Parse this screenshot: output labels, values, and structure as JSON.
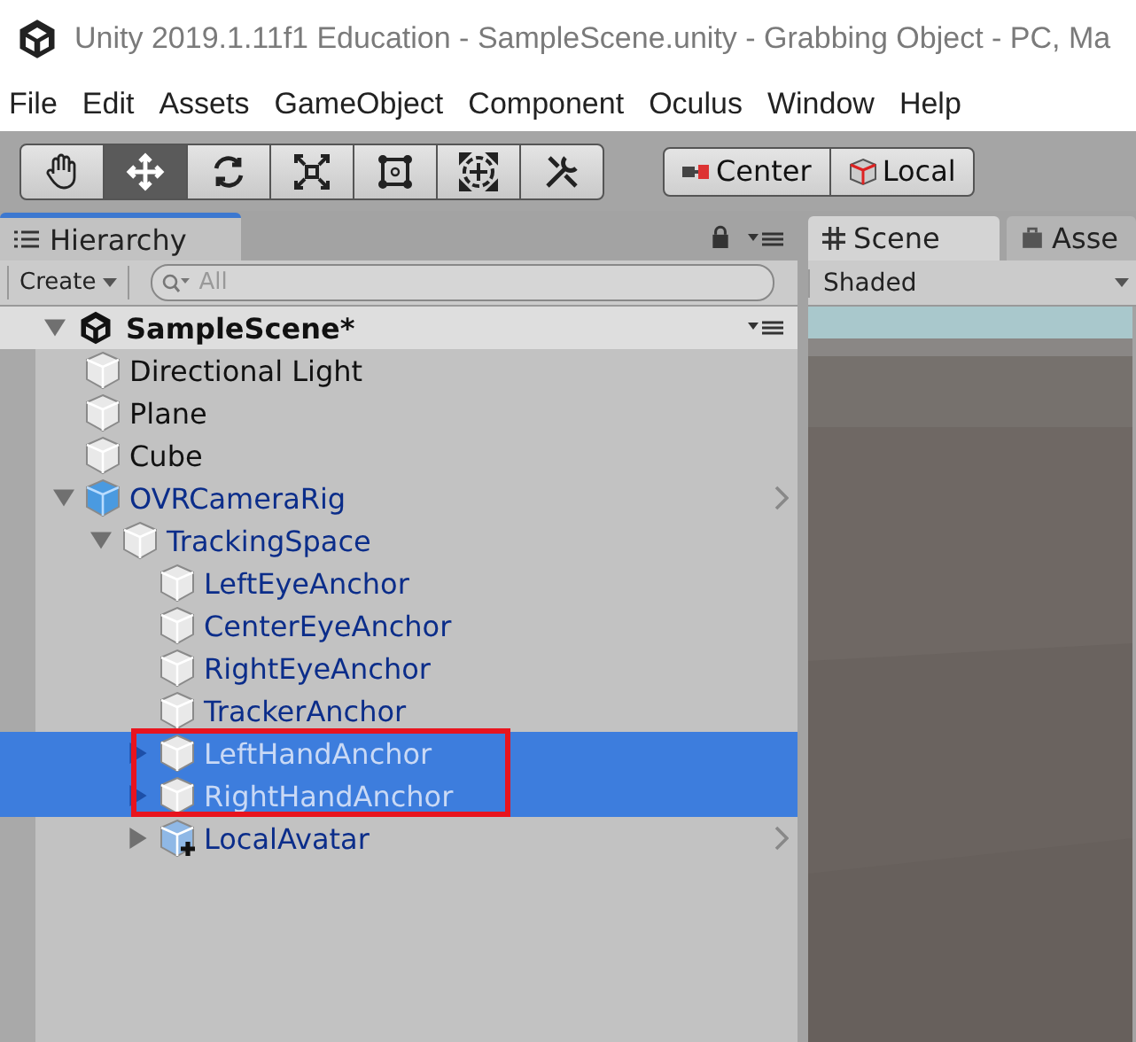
{
  "window": {
    "title": "Unity 2019.1.11f1 Education - SampleScene.unity - Grabbing Object - PC, Ma"
  },
  "menu": [
    "File",
    "Edit",
    "Assets",
    "GameObject",
    "Component",
    "Oculus",
    "Window",
    "Help"
  ],
  "tools": [
    {
      "kind": "hand",
      "selected": false
    },
    {
      "kind": "move",
      "selected": true
    },
    {
      "kind": "rotate",
      "selected": false
    },
    {
      "kind": "scale",
      "selected": false
    },
    {
      "kind": "rect",
      "selected": false
    },
    {
      "kind": "transform",
      "selected": false
    },
    {
      "kind": "custom",
      "selected": false
    }
  ],
  "pivot": [
    "Center",
    "Local"
  ],
  "hierarchy": {
    "tab": "Hierarchy",
    "create": "Create",
    "search": {
      "placeholder": "All"
    },
    "scene": {
      "name": "SampleScene*",
      "expanded": true
    },
    "items": [
      {
        "name": "Directional Light",
        "kind": "object",
        "selected": false
      },
      {
        "name": "Plane",
        "kind": "object",
        "selected": false
      },
      {
        "name": "Cube",
        "kind": "object",
        "selected": false
      },
      {
        "name": "OVRCameraRig",
        "kind": "prefab-root",
        "selected": false,
        "expanded": true,
        "children": [
          {
            "name": "TrackingSpace",
            "kind": "prefab",
            "selected": false,
            "expanded": true,
            "children": [
              {
                "name": "LeftEyeAnchor",
                "kind": "prefab",
                "selected": false
              },
              {
                "name": "CenterEyeAnchor",
                "kind": "prefab",
                "selected": false
              },
              {
                "name": "RightEyeAnchor",
                "kind": "prefab",
                "selected": false
              },
              {
                "name": "TrackerAnchor",
                "kind": "prefab",
                "selected": false
              },
              {
                "name": "LeftHandAnchor",
                "kind": "prefab",
                "selected": true,
                "expanded": false,
                "highlighted": true
              },
              {
                "name": "RightHandAnchor",
                "kind": "prefab",
                "selected": true,
                "expanded": false,
                "highlighted": true
              },
              {
                "name": "LocalAvatar",
                "kind": "added-prefab",
                "selected": false,
                "expanded": false
              }
            ]
          }
        ]
      }
    ]
  },
  "scene_view": {
    "tabs": [
      {
        "label": "Scene",
        "selected": true
      },
      {
        "label": "Asse",
        "selected": false
      }
    ],
    "mode": "Shaded"
  }
}
